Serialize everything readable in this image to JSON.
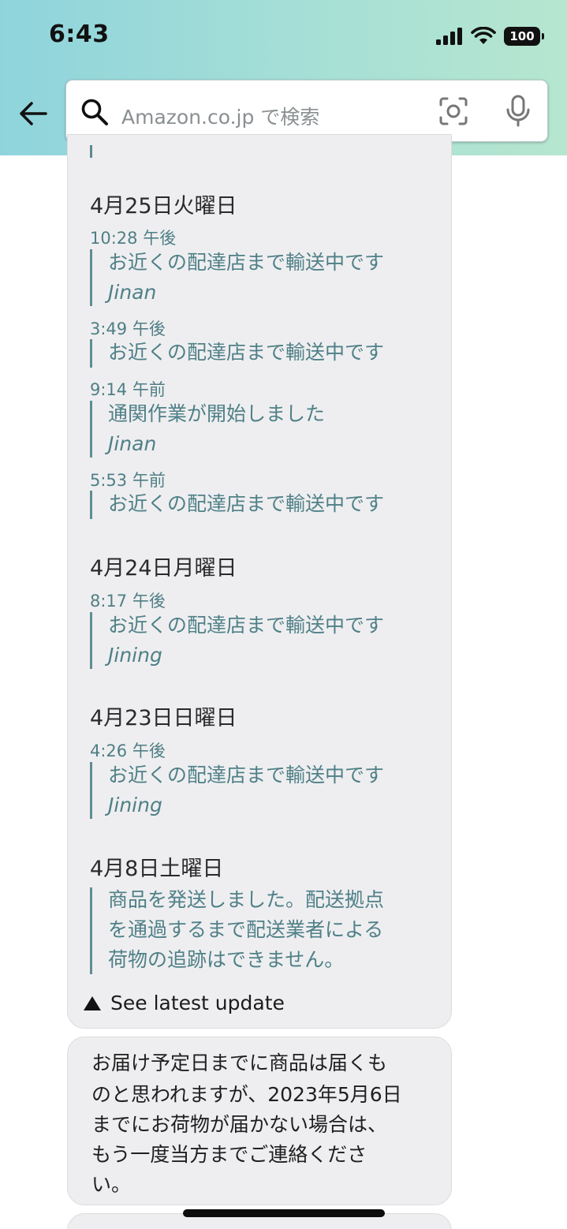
{
  "status_bar": {
    "time": "6:43",
    "battery": "100"
  },
  "search": {
    "placeholder": "Amazon.co.jp で検索"
  },
  "tracking": {
    "days": [
      {
        "date": "4月25日火曜日",
        "events": [
          {
            "time": "10:28 午後",
            "desc": "お近くの配達店まで輸送中です",
            "location": "Jinan"
          },
          {
            "time": "3:49 午後",
            "desc": "お近くの配達店まで輸送中です",
            "location": ""
          },
          {
            "time": "9:14 午前",
            "desc": "通関作業が開始しました",
            "location": "Jinan"
          },
          {
            "time": "5:53 午前",
            "desc": "お近くの配達店まで輸送中です",
            "location": ""
          }
        ]
      },
      {
        "date": "4月24日月曜日",
        "events": [
          {
            "time": "8:17 午後",
            "desc": "お近くの配達店まで輸送中です",
            "location": "Jining"
          }
        ]
      },
      {
        "date": "4月23日日曜日",
        "events": [
          {
            "time": "4:26 午後",
            "desc": "お近くの配達店まで輸送中です",
            "location": "Jining"
          }
        ]
      },
      {
        "date": "4月8日土曜日",
        "events": [
          {
            "desc_lines": [
              "商品を発送しました。配送拠点",
              "を通過するまで配送業者による",
              "荷物の追跡はできません。"
            ]
          }
        ]
      }
    ],
    "see_latest_label": "See latest update"
  },
  "message": {
    "lines": [
      "お届け予定日までに商品は届くも",
      "のと思われますが、2023年5月6日",
      "までにお荷物が届かない場合は、",
      "もう一度当方までご連絡くださ",
      "い。"
    ]
  }
}
